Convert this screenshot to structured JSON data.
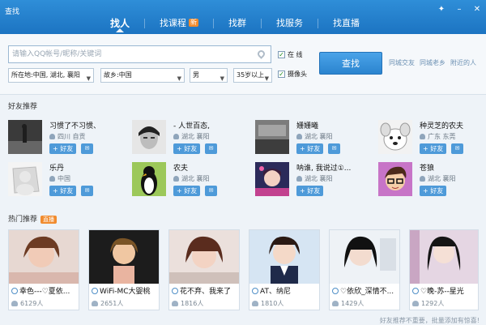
{
  "window": {
    "title": "查找",
    "controls": [
      "shirt-icon",
      "minimize-icon",
      "close-icon"
    ]
  },
  "tabs": [
    {
      "label": "找人",
      "active": true
    },
    {
      "label": "找课程",
      "badge": "新"
    },
    {
      "label": "找群"
    },
    {
      "label": "找服务"
    },
    {
      "label": "找直播"
    }
  ],
  "search": {
    "placeholder": "请输入QQ帐号/昵称/关键词",
    "location": "所在地:中国, 湖北, 襄阳",
    "hometown": "故乡:中国",
    "gender": "男",
    "age": "35岁以上",
    "online_label": "在 线",
    "camera_label": "摄像头",
    "button": "查找",
    "quick_links": [
      "同城交友",
      "同城老乡",
      "附近的人"
    ]
  },
  "friends": {
    "title": "好友推荐",
    "add_label": "+ 好友",
    "msg_label": "✉",
    "items": [
      {
        "name": "习惯了不习惯、",
        "loc": "四川 自贡",
        "avatar": "dark-street"
      },
      {
        "name": "- 人世百态,",
        "loc": "湖北 襄阳",
        "avatar": "bw-face"
      },
      {
        "name": "姗姗曦",
        "loc": "湖北 襄阳",
        "avatar": "gray-photo"
      },
      {
        "name": "种灵芝的农夫",
        "loc": "广东 东莞",
        "avatar": "dog-cartoon"
      },
      {
        "name": "乐丹",
        "loc": "中国",
        "avatar": "default-silhouette"
      },
      {
        "name": "农夫",
        "loc": "湖北 襄阳",
        "avatar": "penguin"
      },
      {
        "name": "呐谁, 我说过①...",
        "loc": "湖北 襄阳",
        "avatar": "anime"
      },
      {
        "name": "苍狼",
        "loc": "湖北 襄阳",
        "avatar": "cartoon-face"
      }
    ]
  },
  "hot": {
    "title": "热门推荐",
    "badge": "直播",
    "items": [
      {
        "name": "幸色---♡夏依...",
        "count": "6129人"
      },
      {
        "name": "WiFi-MC大婴桃",
        "count": "2651人"
      },
      {
        "name": "花不弃、我来了",
        "count": "1816人"
      },
      {
        "name": "AT、纳尼",
        "count": "1810人"
      },
      {
        "name": "♡依欣_深情不...",
        "count": "1429人"
      },
      {
        "name": "♡晚-苏--星光",
        "count": "1292人"
      }
    ]
  },
  "footer": "好友推荐不重要，批量添加有惊喜!"
}
